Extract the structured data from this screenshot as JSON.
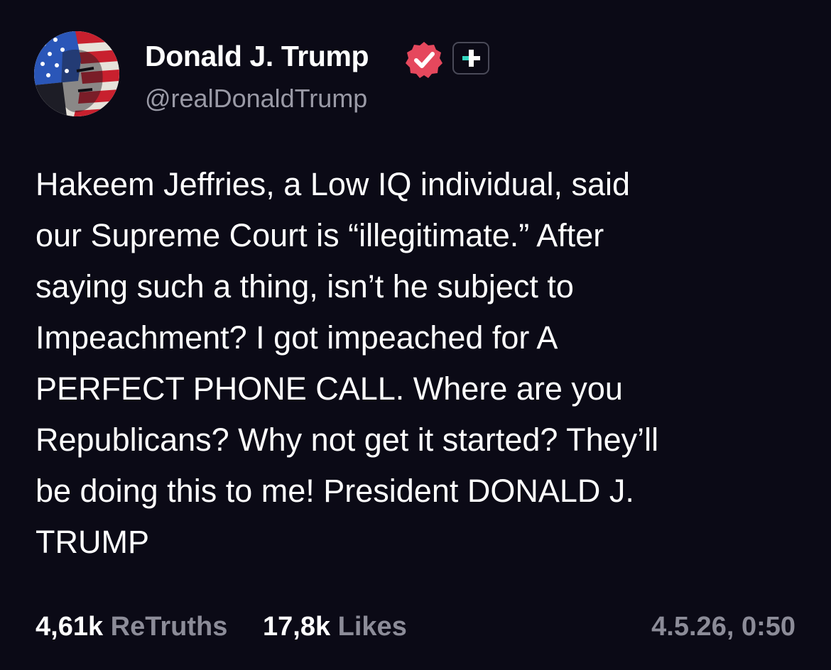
{
  "author": {
    "name": "Donald J. Trump",
    "handle": "@realDonaldTrump",
    "verified_icon": "verified-badge-icon",
    "plus_icon": "plus-subscribe-icon"
  },
  "post": {
    "lines": [
      "Hakeem Jeffries, a Low IQ individual, said",
      "our Supreme Court is “illegitimate.” After",
      "saying such a thing, isn’t he subject to",
      "Impeachment? I got impeached for A",
      "PERFECT PHONE CALL. Where are you",
      "Republicans? Why not get it started? They’ll",
      "be doing this to me! President DONALD J.",
      "TRUMP"
    ]
  },
  "footer": {
    "retruths_count": "4,61k",
    "retruths_label": "ReTruths",
    "likes_count": "17,8k",
    "likes_label": "Likes",
    "timestamp": "4.5.26, 0:50"
  },
  "colors": {
    "background": "#0b0a16",
    "text": "#ffffff",
    "muted": "#8c8c98",
    "verified": "#e5485d",
    "plus_accent": "#33d6c0"
  }
}
